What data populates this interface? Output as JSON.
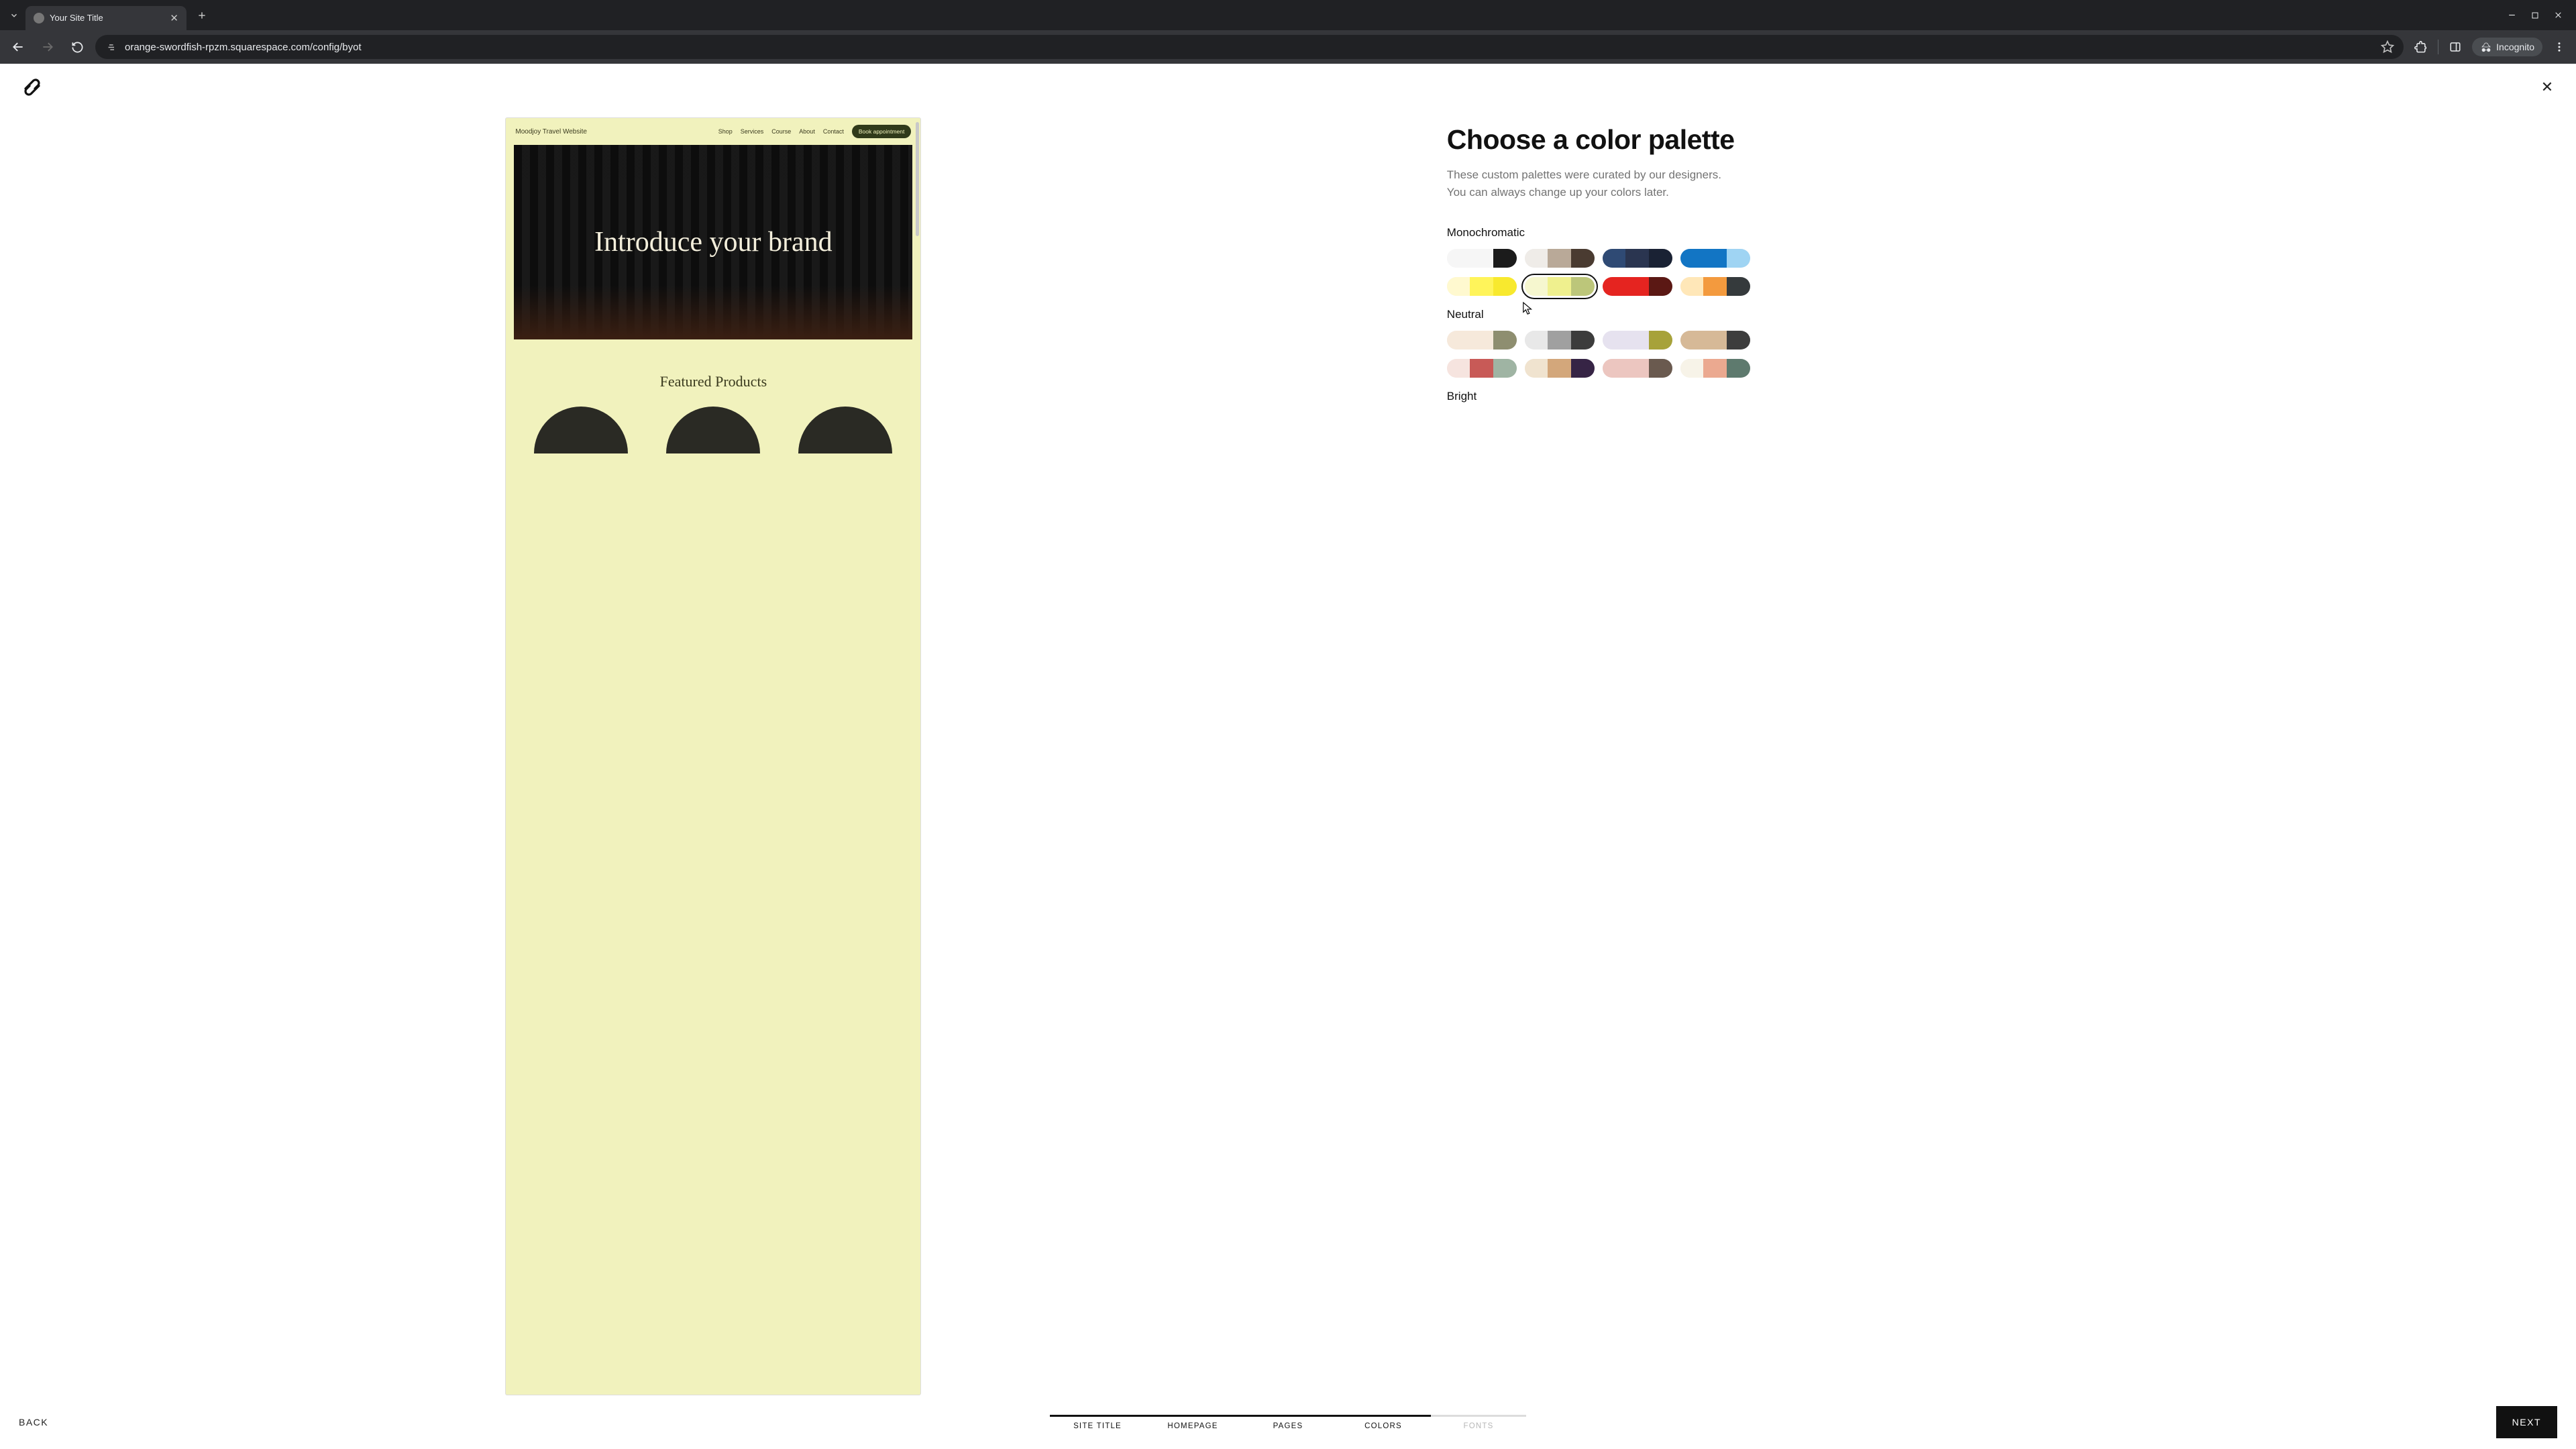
{
  "browser": {
    "tab_title": "Your Site Title",
    "url_display": "orange-swordfish-rpzm.squarespace.com/config/byot",
    "incognito_label": "Incognito"
  },
  "preview": {
    "brand": "Moodjoy Travel Website",
    "nav": [
      "Shop",
      "Services",
      "Course",
      "About",
      "Contact"
    ],
    "cta": "Book appointment",
    "hero_title": "Introduce your brand",
    "section2_title": "Featured Products"
  },
  "picker": {
    "heading": "Choose a color palette",
    "subtitle": "These custom palettes were curated by our designers. You can always change up your colors later.",
    "groups": [
      {
        "title": "Monochromatic",
        "palettes": [
          {
            "id": "mono-bw",
            "selected": false,
            "colors": [
              "#f6f6f6",
              "#f6f6f6",
              "#1b1b1b"
            ]
          },
          {
            "id": "mono-taupe",
            "selected": false,
            "colors": [
              "#efece8",
              "#b9a998",
              "#4a3b31"
            ]
          },
          {
            "id": "mono-navy",
            "selected": false,
            "colors": [
              "#2f4a74",
              "#2a3550",
              "#1a2234"
            ]
          },
          {
            "id": "mono-blue",
            "selected": false,
            "colors": [
              "#1275c4",
              "#1275c4",
              "#9fd4f3"
            ]
          },
          {
            "id": "mono-yellow",
            "selected": false,
            "colors": [
              "#fff9cf",
              "#fff45a",
              "#f8e92e"
            ]
          },
          {
            "id": "mono-chartreuse",
            "selected": true,
            "colors": [
              "#f6f7cf",
              "#eff08e",
              "#bcc67a"
            ]
          },
          {
            "id": "mono-red",
            "selected": false,
            "colors": [
              "#e52420",
              "#e52420",
              "#5b1814"
            ]
          },
          {
            "id": "mono-orange",
            "selected": false,
            "colors": [
              "#ffe7b8",
              "#f39a3e",
              "#353a3c"
            ]
          }
        ]
      },
      {
        "title": "Neutral",
        "palettes": [
          {
            "id": "neu-1",
            "selected": false,
            "colors": [
              "#f6e9db",
              "#f6e9db",
              "#8e8e70"
            ]
          },
          {
            "id": "neu-2",
            "selected": false,
            "colors": [
              "#e8e8e8",
              "#a0a0a0",
              "#3c3c3c"
            ]
          },
          {
            "id": "neu-3",
            "selected": false,
            "colors": [
              "#e6e2ef",
              "#e6e2ef",
              "#a7a23a"
            ]
          },
          {
            "id": "neu-4",
            "selected": false,
            "colors": [
              "#d6b997",
              "#d6b997",
              "#3d3d3d"
            ]
          },
          {
            "id": "neu-5",
            "selected": false,
            "colors": [
              "#f6e4df",
              "#c85a57",
              "#9fb4a3"
            ]
          },
          {
            "id": "neu-6",
            "selected": false,
            "colors": [
              "#f0e3cf",
              "#d3a77b",
              "#362445"
            ]
          },
          {
            "id": "neu-7",
            "selected": false,
            "colors": [
              "#ecc6c0",
              "#ecc6c0",
              "#6a5a4f"
            ]
          },
          {
            "id": "neu-8",
            "selected": false,
            "colors": [
              "#f7f3e8",
              "#eba990",
              "#5e7a6e"
            ]
          }
        ]
      },
      {
        "title": "Bright",
        "palettes": []
      }
    ]
  },
  "footer": {
    "back": "BACK",
    "next": "NEXT",
    "steps": [
      {
        "label": "SITE TITLE",
        "active": true
      },
      {
        "label": "HOMEPAGE",
        "active": true
      },
      {
        "label": "PAGES",
        "active": true
      },
      {
        "label": "COLORS",
        "active": true
      },
      {
        "label": "FONTS",
        "active": false
      }
    ]
  }
}
